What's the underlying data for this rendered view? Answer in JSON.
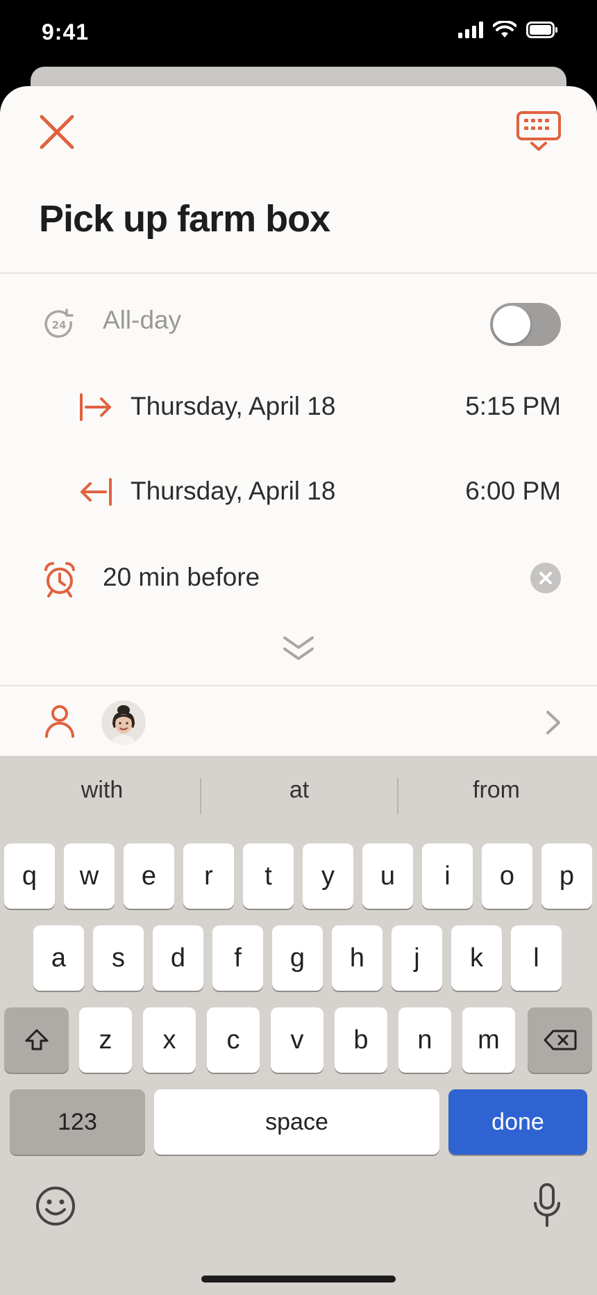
{
  "status_bar": {
    "time": "9:41"
  },
  "event": {
    "title": "Pick up farm box",
    "all_day_label": "All-day",
    "all_day_on": false,
    "start": {
      "date": "Thursday, April 18",
      "time": "5:15 PM"
    },
    "end": {
      "date": "Thursday, April 18",
      "time": "6:00 PM"
    },
    "reminder": "20 min before",
    "icons": {
      "close": "close-icon",
      "keyboard": "keyboard-dismiss-icon",
      "all_day": "24-hour-icon",
      "start": "arrow-right-bar-icon",
      "end": "arrow-left-bar-icon",
      "reminder": "alarm-icon",
      "clear": "clear-icon",
      "expand": "double-chevron-down-icon",
      "person": "person-icon",
      "chevron": "chevron-right-icon"
    }
  },
  "colors": {
    "accent": "#e0623f",
    "done_key": "#2f63d1",
    "keyboard_bg": "#d6d2cd"
  },
  "keyboard": {
    "suggestions": [
      "with",
      "at",
      "from"
    ],
    "row1": [
      "q",
      "w",
      "e",
      "r",
      "t",
      "y",
      "u",
      "i",
      "o",
      "p"
    ],
    "row2": [
      "a",
      "s",
      "d",
      "f",
      "g",
      "h",
      "j",
      "k",
      "l"
    ],
    "row3": [
      "z",
      "x",
      "c",
      "v",
      "b",
      "n",
      "m"
    ],
    "numbers_label": "123",
    "space_label": "space",
    "done_label": "done"
  }
}
